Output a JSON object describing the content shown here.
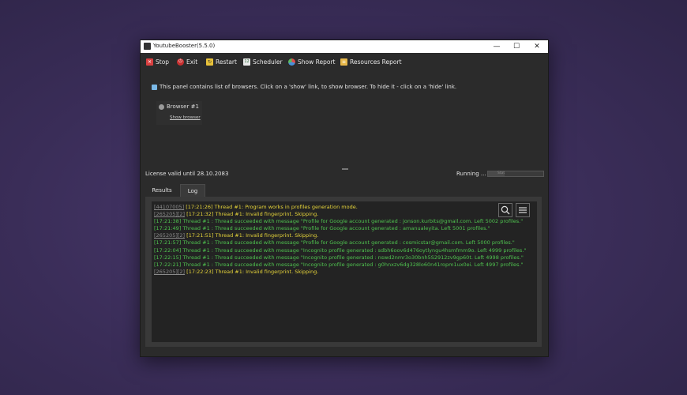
{
  "window": {
    "title": "YoutubeBooster(5.5.0)",
    "controls": {
      "minimize": "—",
      "maximize": "☐",
      "close": "✕"
    }
  },
  "toolbar": {
    "items": [
      {
        "label": "Stop",
        "icon": "stop-icon",
        "color": "#d94040"
      },
      {
        "label": "Exit",
        "icon": "power-icon",
        "color": "#c83030"
      },
      {
        "label": "Restart",
        "icon": "restart-icon",
        "color": "#e8c23a"
      },
      {
        "label": "Scheduler",
        "icon": "calendar-icon",
        "color": "#3a8a4a"
      },
      {
        "label": "Show Report",
        "icon": "pie-chart-icon",
        "color": "#4a90d9"
      },
      {
        "label": "Resources Report",
        "icon": "report-icon",
        "color": "#e8b84a"
      }
    ]
  },
  "info_text": "This panel contains list of browsers. Click on a 'show' link, to show browser. To hide it - click on a 'hide' link.",
  "browser": {
    "label": "Browser #1",
    "link": "Show browser"
  },
  "status": {
    "license": "License valid until 28.10.2083",
    "running": "Running ...",
    "progress_text": "Stat",
    "progress_fraction": 0.3
  },
  "tabs": {
    "results": "Results",
    "log": "Log"
  },
  "log": {
    "lines": [
      {
        "id": "[44107005]",
        "text": "[17:21:26] Thread #1: Program works in profiles generation mode.",
        "color": "yellow"
      },
      {
        "id": "[265205][2]",
        "text": "[17:21:32] Thread #1: Invalid fingerprint. Skipping.",
        "color": "yellow"
      },
      {
        "id": "",
        "text": "[17:21:38] Thread #1 : Thread succeeded with message \"Profile for Google account generated : jonson.kurbits@gmail.com. Left 5002 profiles.\"",
        "color": "green"
      },
      {
        "id": "",
        "text": "[17:21:49] Thread #1 : Thread succeeded with message \"Profile for Google account generated : amanualeyita. Left 5001 profiles.\"",
        "color": "green"
      },
      {
        "id": "[265205][2]",
        "text": "[17:21:51] Thread #1: Invalid fingerprint. Skipping.",
        "color": "yellow"
      },
      {
        "id": "",
        "text": "[17:21:57] Thread #1 : Thread succeeded with message \"Profile for Google account generated : cosmicstar@gmail.com. Left 5000 profiles.\"",
        "color": "green"
      },
      {
        "id": "",
        "text": "[17:22:04] Thread #1 : Thread succeeded with message \"Incognito profile generated : sdbh6oov6d476oytlyngu4hsmfmm9o. Left 4999 profiles.\"",
        "color": "green"
      },
      {
        "id": "",
        "text": "[17:22:15] Thread #1 : Thread succeeded with message \"Incognito profile generated : nswd2nmr3o30bnh5S2912zv9gp60t. Left 4998 profiles.\"",
        "color": "green"
      },
      {
        "id": "",
        "text": "[17:22:21] Thread #1 : Thread succeeded with message \"Incognito profile generated : g0hnxzv6dg328lo60n41ropm1ux0ei. Left 4997 profiles.\"",
        "color": "green"
      },
      {
        "id": "[265205][2]",
        "text": "[17:22:23] Thread #1: Invalid fingerprint. Skipping.",
        "color": "yellow"
      }
    ]
  }
}
